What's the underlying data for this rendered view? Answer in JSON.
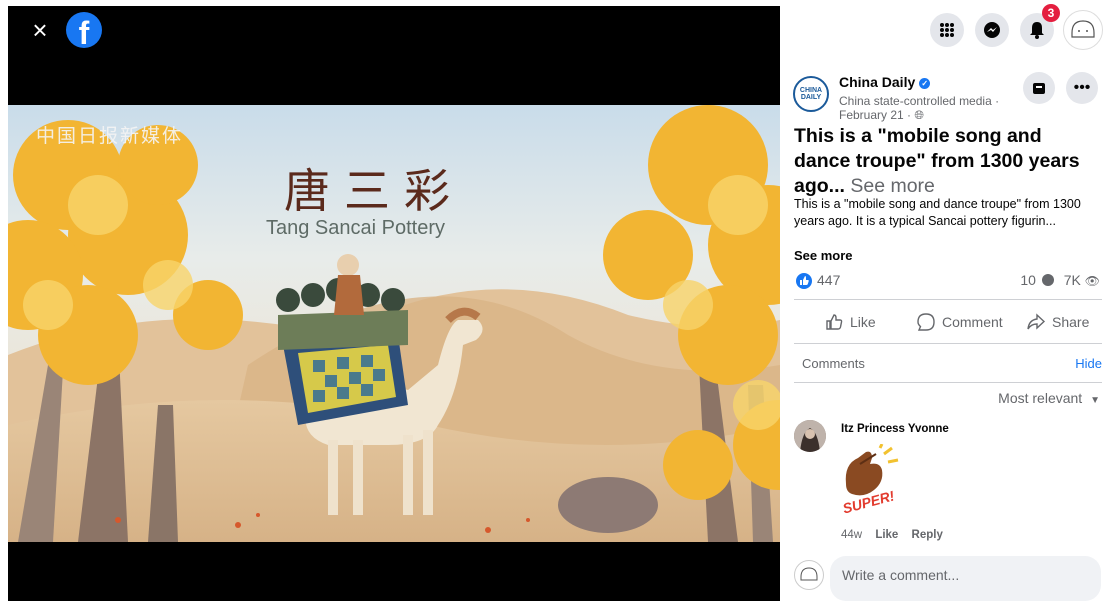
{
  "viewer": {
    "close_glyph": "×",
    "logo_letter": "f",
    "video": {
      "watermark": "中国日报新媒体",
      "title_cn": "唐三彩",
      "title_en": "Tang Sancai Pottery"
    }
  },
  "topbar": {
    "menu_icon": "grid-menu-icon",
    "messenger_icon": "messenger-icon",
    "notifications_icon": "bell-icon",
    "notification_count": "3",
    "profile_icon": "profile-avatar"
  },
  "post": {
    "page_name": "China Daily",
    "avatar_text": "CHINA DAILY",
    "page_subtitle": "China state-controlled media ·",
    "date": "February 21 ·",
    "headline": "This is a \"mobile song and dance troupe\" from 1300 years ago...",
    "headline_see_more": "See more",
    "body": "This is a \"mobile song and dance troupe\" from 1300 years ago. It is a typical Sancai pottery figurin...",
    "see_more": "See more",
    "like_count": "447",
    "comment_count": "10",
    "view_count": "7K"
  },
  "actions": {
    "like": "Like",
    "comment": "Comment",
    "share": "Share"
  },
  "comments": {
    "label": "Comments",
    "hide": "Hide",
    "sort": "Most relevant",
    "items": [
      {
        "author": "Itz Princess Yvonne",
        "sticker_text": "SUPER!",
        "time": "44w",
        "like": "Like",
        "reply": "Reply"
      }
    ],
    "write_placeholder": "Write a comment..."
  },
  "colors": {
    "accent": "#1877f2",
    "badge": "#e41e3f"
  }
}
